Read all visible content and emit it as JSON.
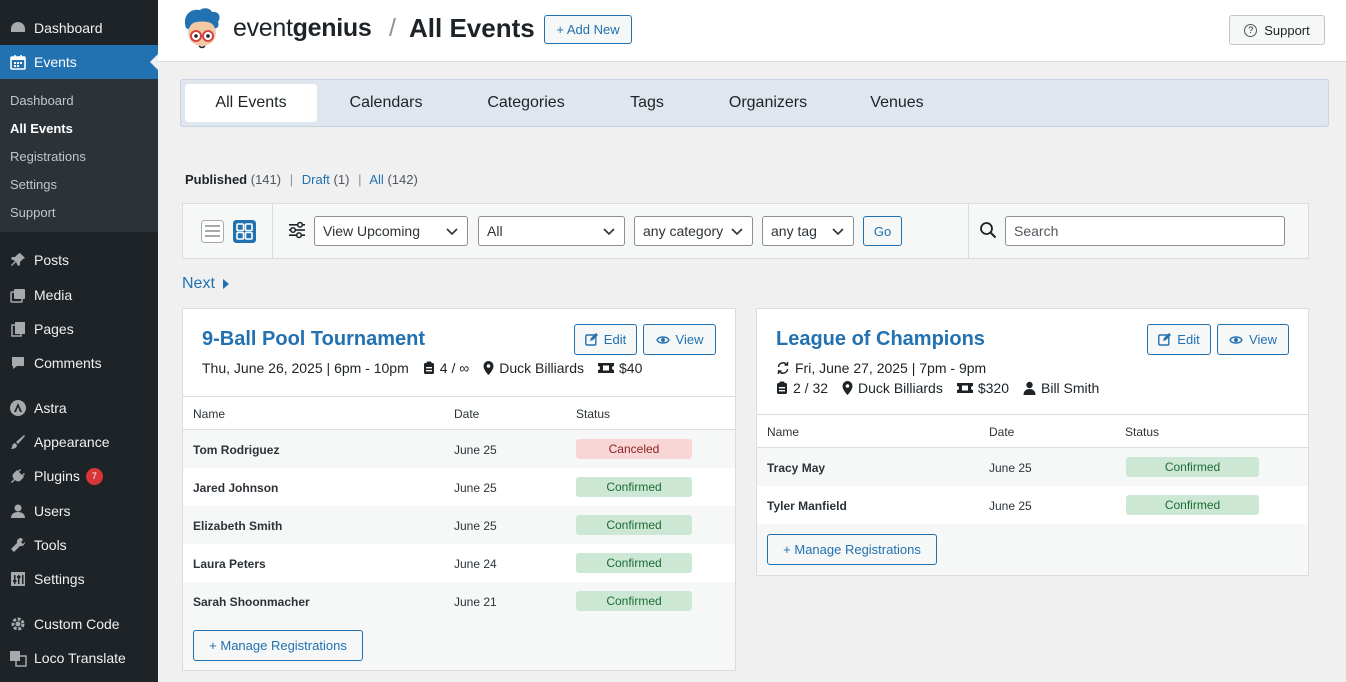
{
  "sidebar": {
    "items": [
      {
        "label": "Dashboard",
        "icon": "dashboard-icon"
      },
      {
        "label": "Events",
        "icon": "calendar-icon"
      },
      {
        "label": "Posts",
        "icon": "pin-icon"
      },
      {
        "label": "Media",
        "icon": "media-icon"
      },
      {
        "label": "Pages",
        "icon": "pages-icon"
      },
      {
        "label": "Comments",
        "icon": "comment-icon"
      },
      {
        "label": "Astra",
        "icon": "astra-icon"
      },
      {
        "label": "Appearance",
        "icon": "brush-icon"
      },
      {
        "label": "Plugins",
        "icon": "plugin-icon",
        "badge": "7"
      },
      {
        "label": "Users",
        "icon": "user-icon"
      },
      {
        "label": "Tools",
        "icon": "wrench-icon"
      },
      {
        "label": "Settings",
        "icon": "sliders-icon"
      },
      {
        "label": "Custom Code",
        "icon": "gear-icon"
      },
      {
        "label": "Loco Translate",
        "icon": "translate-icon"
      }
    ],
    "submenu": [
      "Dashboard",
      "All Events",
      "Registrations",
      "Settings",
      "Support"
    ]
  },
  "header": {
    "brand_light": "event",
    "brand_bold": "genius",
    "separator": "/",
    "title": "All Events",
    "add_new": "+ Add New",
    "support": "Support"
  },
  "tabs": [
    "All Events",
    "Calendars",
    "Categories",
    "Tags",
    "Organizers",
    "Venues"
  ],
  "status_links": {
    "published": "Published",
    "published_count": "(141)",
    "draft": "Draft",
    "draft_count": "(1)",
    "all": "All",
    "all_count": "(142)",
    "pipe": "|"
  },
  "filters": {
    "view": "View Upcoming",
    "calendar": "All",
    "category": "any category",
    "tag": "any tag",
    "go": "Go",
    "search_placeholder": "Search"
  },
  "pagination": {
    "next": "Next"
  },
  "colors": {
    "accent": "#2271b1",
    "sidebar": "#1d2327",
    "confirmed_bg": "#cce8d4",
    "canceled_bg": "#f9d6d6",
    "badge": "#d63638"
  },
  "cards": [
    {
      "title": "9-Ball Pool Tournament",
      "edit": "Edit",
      "view": "View",
      "date": "Thu, June 26, 2025 | 6pm - 10pm",
      "capacity": "4 / ∞",
      "venue": "Duck Billiards",
      "price": "$40",
      "columns": [
        "Name",
        "Date",
        "Status"
      ],
      "rows": [
        {
          "name": "Tom Rodriguez",
          "date": "June 25",
          "status": "Canceled"
        },
        {
          "name": "Jared Johnson",
          "date": "June 25",
          "status": "Confirmed"
        },
        {
          "name": "Elizabeth Smith",
          "date": "June 25",
          "status": "Confirmed"
        },
        {
          "name": "Laura Peters",
          "date": "June 24",
          "status": "Confirmed"
        },
        {
          "name": "Sarah Shoonmacher",
          "date": "June 21",
          "status": "Confirmed"
        }
      ],
      "manage": "+ Manage Registrations"
    },
    {
      "title": "League of Champions",
      "edit": "Edit",
      "view": "View",
      "date": "Fri, June 27, 2025 | 7pm - 9pm",
      "capacity": "2 / 32",
      "venue": "Duck Billiards",
      "price": "$320",
      "organizer": "Bill Smith",
      "columns": [
        "Name",
        "Date",
        "Status"
      ],
      "rows": [
        {
          "name": "Tracy May",
          "date": "June 25",
          "status": "Confirmed"
        },
        {
          "name": "Tyler Manfield",
          "date": "June 25",
          "status": "Confirmed"
        }
      ],
      "manage": "+ Manage Registrations"
    }
  ]
}
